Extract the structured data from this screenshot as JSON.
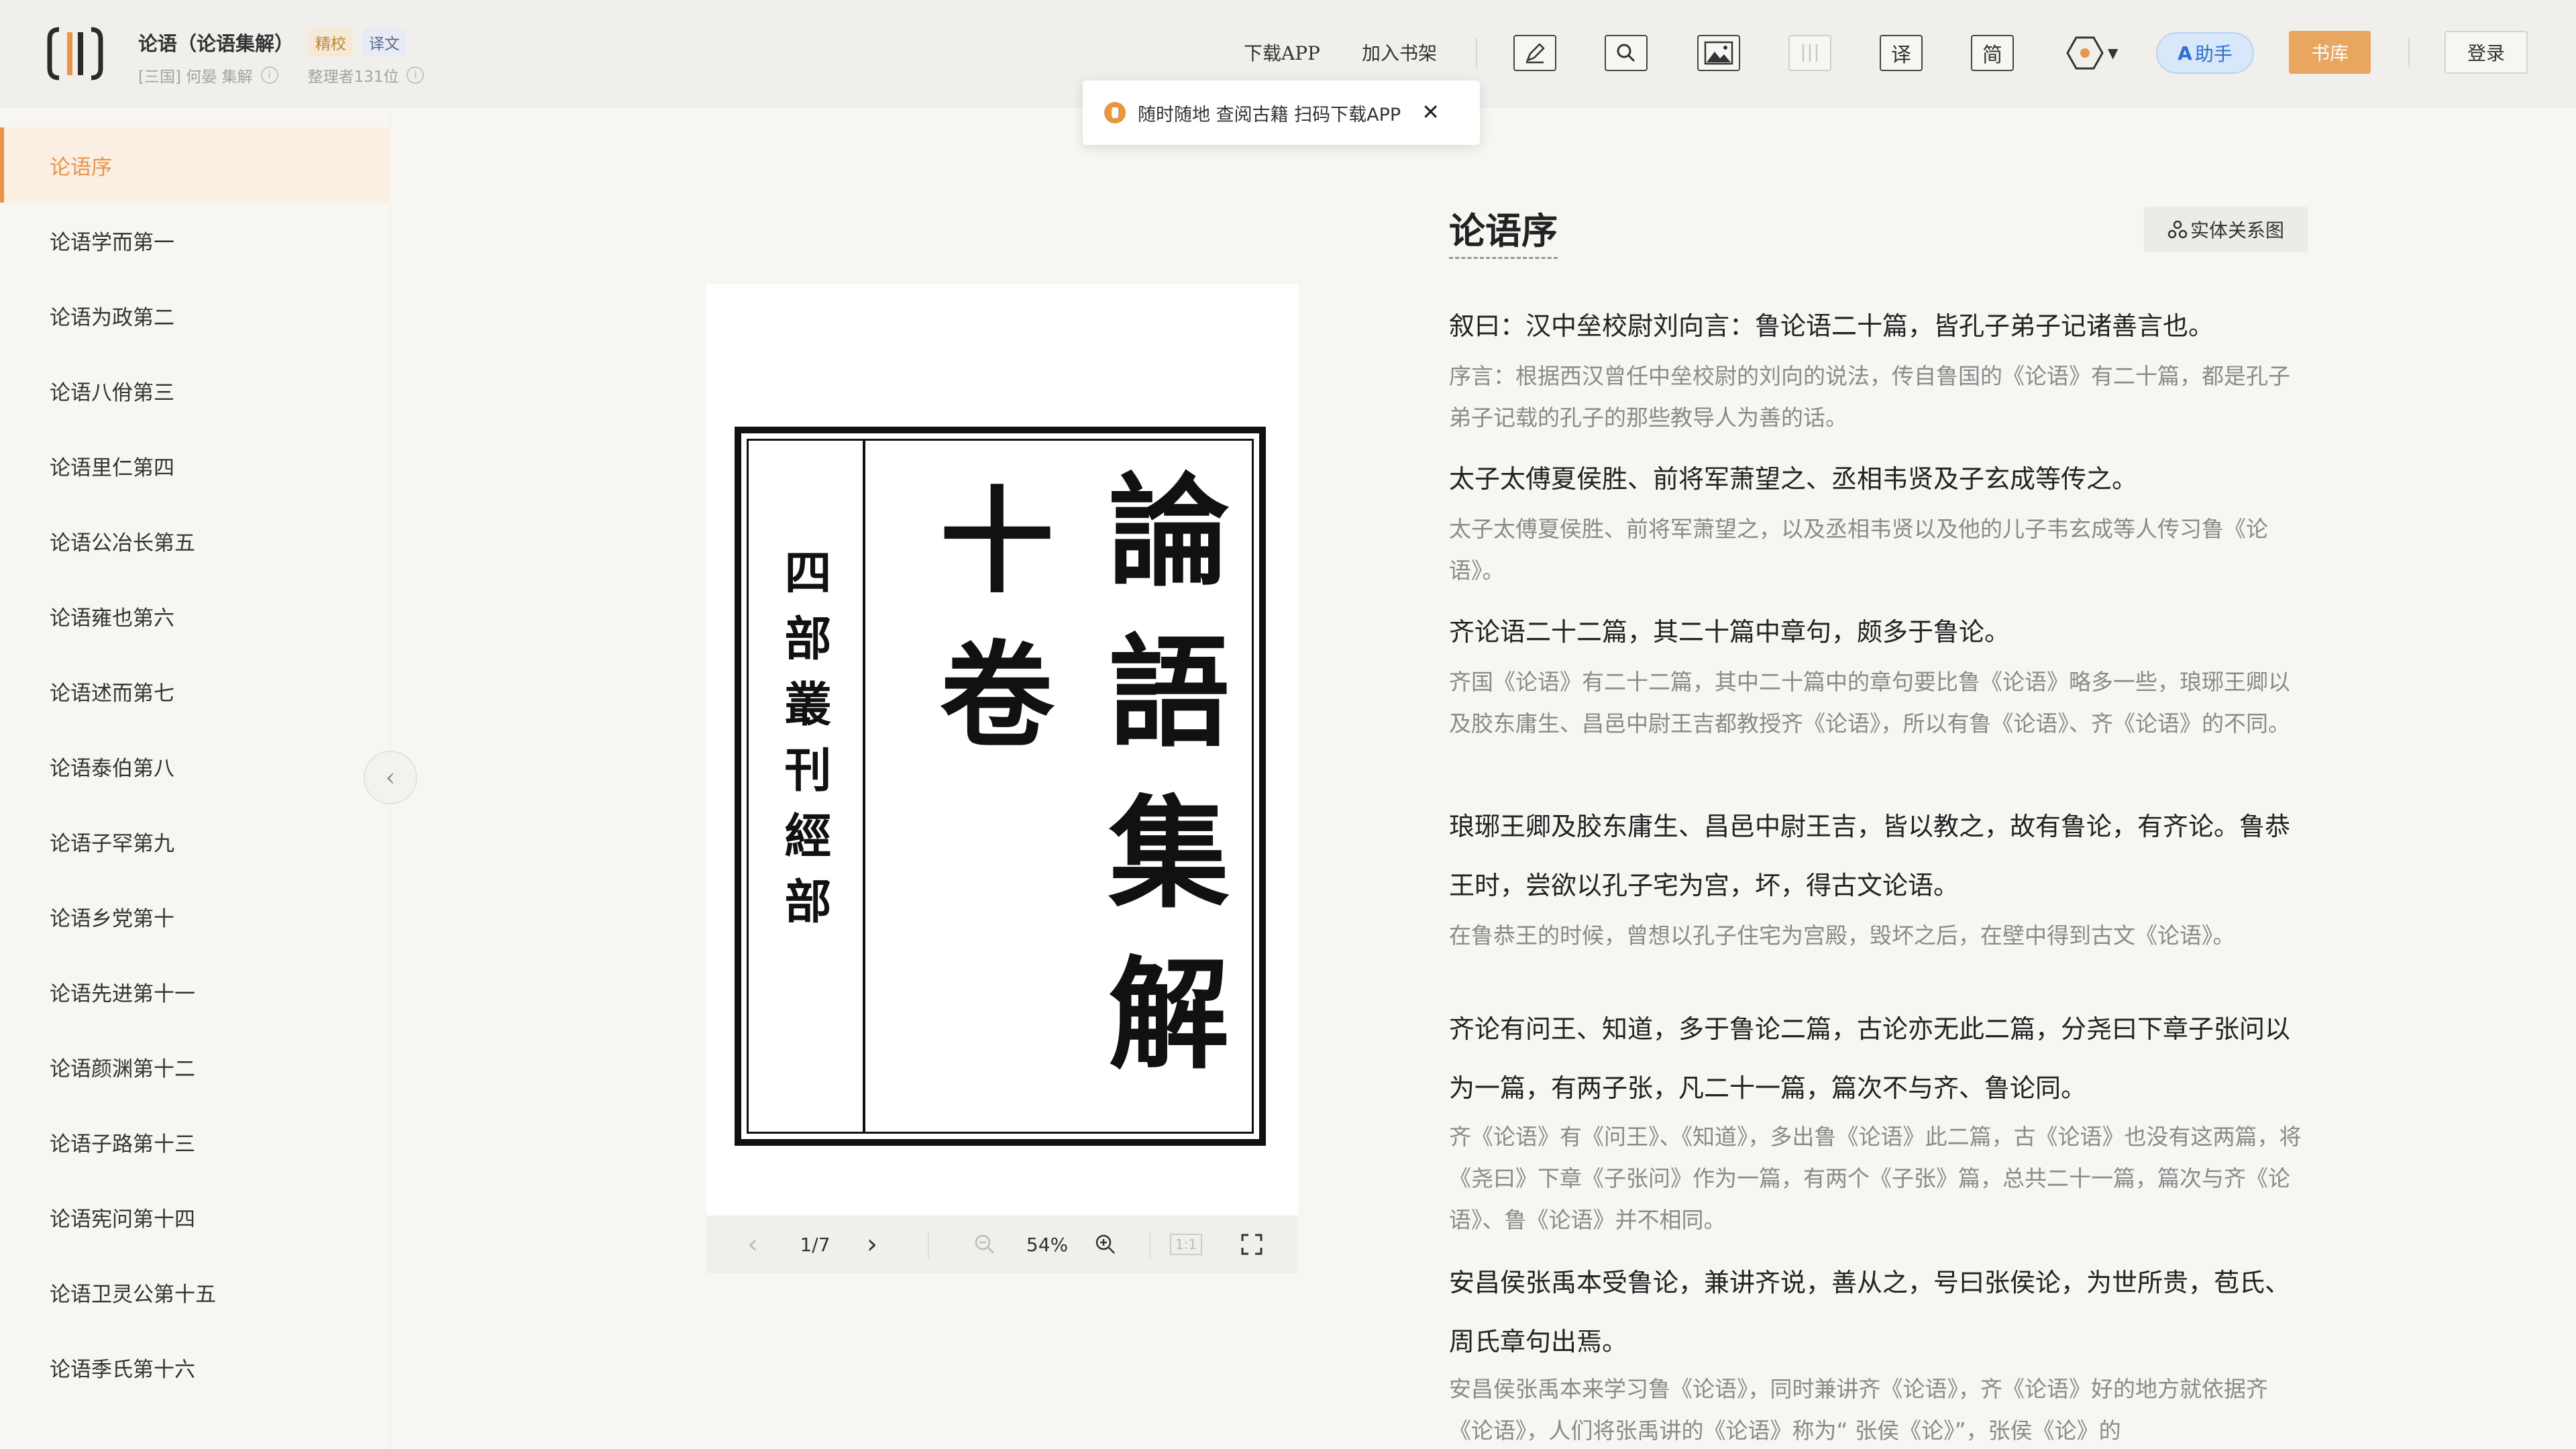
{
  "header": {
    "book_title": "论语（论语集解）",
    "badge_jingjiao": "精校",
    "badge_yiwen": "译文",
    "author": "[三国] 何晏 集解",
    "editors": "整理者131位",
    "nav": {
      "download_app": "下载APP",
      "add_shelf": "加入书架"
    },
    "tools": {
      "translate": "译",
      "simplified": "简"
    },
    "assistant": "助手",
    "library": "书库",
    "login": "登录"
  },
  "popup": {
    "text": "随时随地 查阅古籍 扫码下载APP"
  },
  "sidebar": {
    "items": [
      {
        "label": "论语序",
        "active": true
      },
      {
        "label": "论语学而第一"
      },
      {
        "label": "论语为政第二"
      },
      {
        "label": "论语八佾第三"
      },
      {
        "label": "论语里仁第四"
      },
      {
        "label": "论语公冶长第五"
      },
      {
        "label": "论语雍也第六"
      },
      {
        "label": "论语述而第七"
      },
      {
        "label": "论语泰伯第八"
      },
      {
        "label": "论语子罕第九"
      },
      {
        "label": "论语乡党第十"
      },
      {
        "label": "论语先进第十一"
      },
      {
        "label": "论语颜渊第十二"
      },
      {
        "label": "论语子路第十三"
      },
      {
        "label": "论语宪问第十四"
      },
      {
        "label": "论语卫灵公第十五"
      },
      {
        "label": "论语季氏第十六"
      }
    ]
  },
  "viewer": {
    "page_calligraphy_main": "論語集解",
    "page_calligraphy_side": "十卷",
    "page_calligraphy_series": "四部叢刊經部",
    "page_indicator": "1/7",
    "zoom": "54%",
    "actual_size": "1:1"
  },
  "reader": {
    "title": "论语序",
    "graph_button": "实体关系图",
    "paragraphs": [
      {
        "orig": "叙曰：汉中垒校尉刘向言：鲁论语二十篇，皆孔子弟子记诸善言也。",
        "trans": "序言：根据西汉曾任中垒校尉的刘向的说法，传自鲁国的《论语》有二十篇，都是孔子弟子记载的孔子的那些教导人为善的话。"
      },
      {
        "orig": "太子太傅夏侯胜、前将军萧望之、丞相韦贤及子玄成等传之。",
        "trans": "太子太傅夏侯胜、前将军萧望之，以及丞相韦贤以及他的儿子韦玄成等人传习鲁《论语》。"
      },
      {
        "orig": "齐论语二十二篇，其二十篇中章句，颇多于鲁论。",
        "trans": "齐国《论语》有二十二篇，其中二十篇中的章句要比鲁《论语》略多一些，琅琊王卿以及胶东庸生、昌邑中尉王吉都教授齐《论语》，所以有鲁《论语》、齐《论语》的不同。"
      },
      {
        "orig": " 琅琊王卿及胶东庸生、昌邑中尉王吉，皆以教之，故有鲁论，有齐论。鲁恭王时，尝欲以孔子宅为宫，坏，得古文论语。",
        "trans": "在鲁恭王的时候，曾想以孔子住宅为宫殿，毁坏之后，在壁中得到古文《论语》。"
      },
      {
        "orig": "齐论有问王、知道，多于鲁论二篇，古论亦无此二篇，分尧曰下章子张问以为一篇，有两子张，凡二十一篇，篇次不与齐、鲁论同。",
        "trans": "齐《论语》有《问王》、《知道》，多出鲁《论语》此二篇，古《论语》也没有这两篇，将《尧曰》下章《子张问》作为一篇，有两个《子张》篇，总共二十一篇，篇次与齐《论语》、鲁《论语》并不相同。"
      },
      {
        "orig": "安昌侯张禹本受鲁论，兼讲齐说，善从之，号曰张侯论，为世所贵，苞氏、周氏章句出焉。",
        "trans": "安昌侯张禹本来学习鲁《论语》，同时兼讲齐《论语》，齐《论语》好的地方就依据齐《论语》，人们将张禹讲的《论语》称为“ 张侯《论》”，张侯《论》的"
      }
    ]
  }
}
